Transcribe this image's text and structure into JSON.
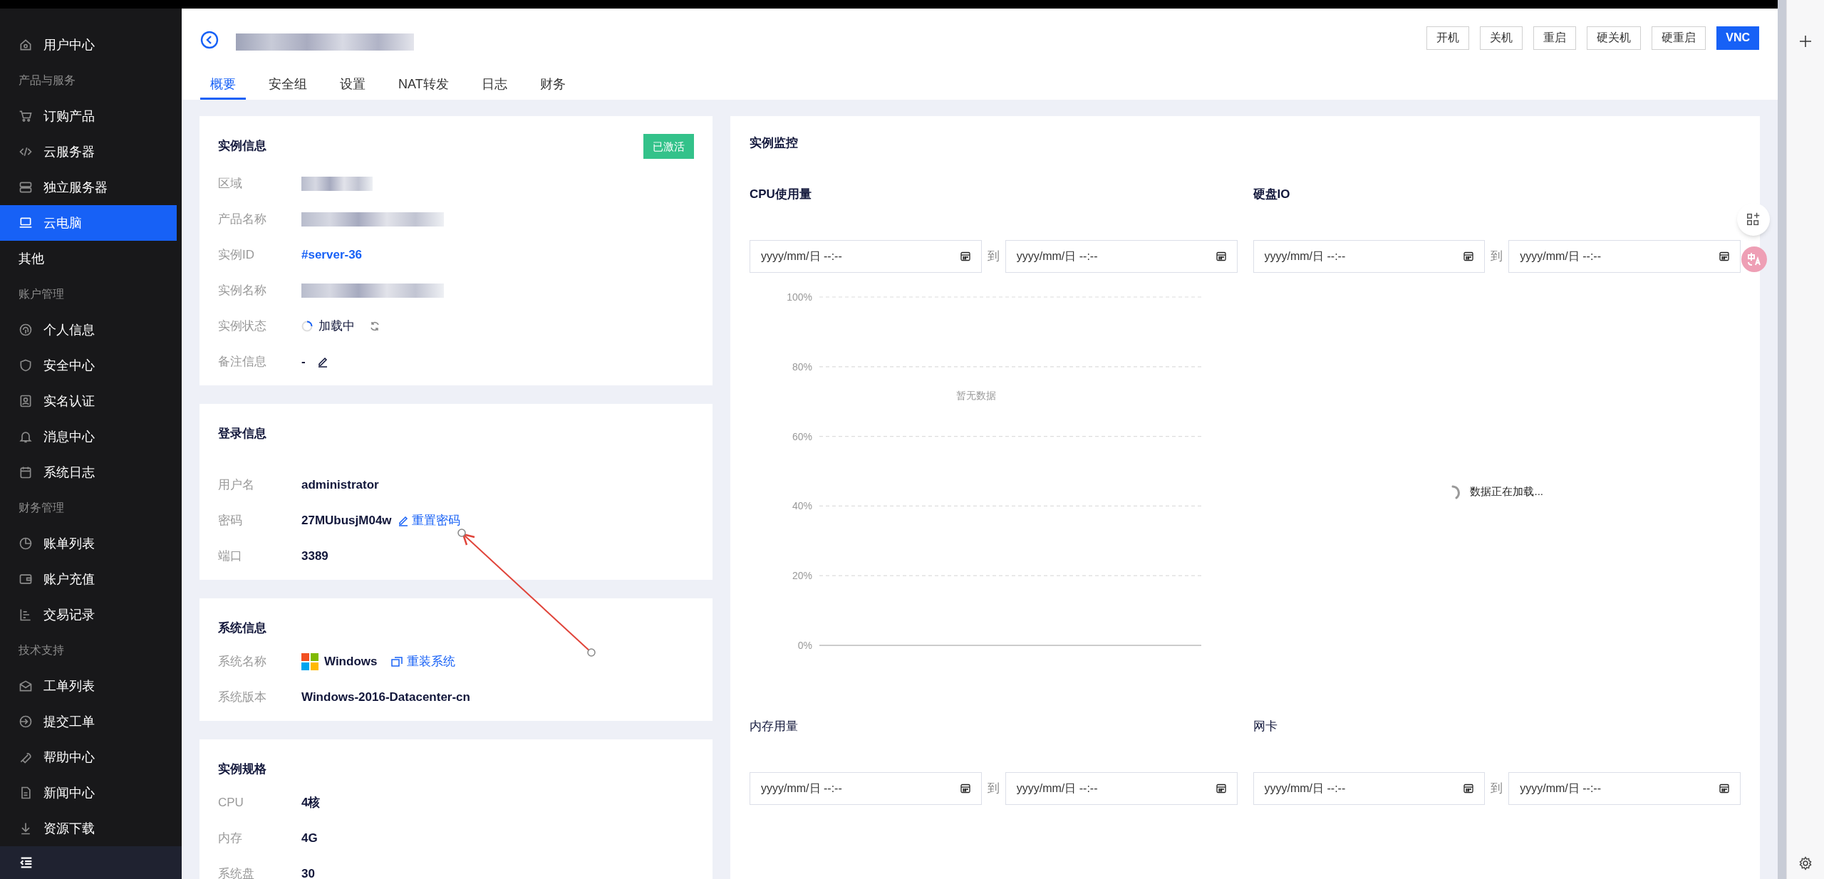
{
  "sidebar": {
    "items": [
      {
        "kind": "item",
        "label": "用户中心",
        "selected": false
      },
      {
        "kind": "section",
        "label": "产品与服务"
      },
      {
        "kind": "item",
        "label": "订购产品",
        "selected": false
      },
      {
        "kind": "item",
        "label": "云服务器",
        "selected": false
      },
      {
        "kind": "item",
        "label": "独立服务器",
        "selected": false
      },
      {
        "kind": "item",
        "label": "云电脑",
        "selected": true
      },
      {
        "kind": "plain",
        "label": "其他",
        "selected": false
      },
      {
        "kind": "section",
        "label": "账户管理"
      },
      {
        "kind": "item",
        "label": "个人信息",
        "selected": false
      },
      {
        "kind": "item",
        "label": "安全中心",
        "selected": false
      },
      {
        "kind": "item",
        "label": "实名认证",
        "selected": false
      },
      {
        "kind": "item",
        "label": "消息中心",
        "selected": false
      },
      {
        "kind": "item",
        "label": "系统日志",
        "selected": false
      },
      {
        "kind": "section",
        "label": "财务管理"
      },
      {
        "kind": "item",
        "label": "账单列表",
        "selected": false
      },
      {
        "kind": "item",
        "label": "账户充值",
        "selected": false
      },
      {
        "kind": "item",
        "label": "交易记录",
        "selected": false
      },
      {
        "kind": "section",
        "label": "技术支持"
      },
      {
        "kind": "item",
        "label": "工单列表",
        "selected": false
      },
      {
        "kind": "item",
        "label": "提交工单",
        "selected": false
      },
      {
        "kind": "item",
        "label": "帮助中心",
        "selected": false
      },
      {
        "kind": "item",
        "label": "新闻中心",
        "selected": false
      },
      {
        "kind": "item",
        "label": "资源下载",
        "selected": false
      }
    ]
  },
  "header": {
    "tabs": [
      {
        "label": "概要",
        "selected": true
      },
      {
        "label": "安全组",
        "selected": false
      },
      {
        "label": "设置",
        "selected": false
      },
      {
        "label": "NAT转发",
        "selected": false
      },
      {
        "label": "日志",
        "selected": false
      },
      {
        "label": "财务",
        "selected": false
      }
    ],
    "buttons": [
      {
        "label": "开机",
        "primary": false
      },
      {
        "label": "关机",
        "primary": false
      },
      {
        "label": "重启",
        "primary": false
      },
      {
        "label": "硬关机",
        "primary": false
      },
      {
        "label": "硬重启",
        "primary": false
      },
      {
        "label": "VNC",
        "primary": true
      }
    ]
  },
  "cards": [
    {
      "title": "实例信息",
      "badge": "已激活",
      "rows": [
        {
          "kind": "redacted",
          "label": "区域"
        },
        {
          "kind": "redacted",
          "label": "产品名称"
        },
        {
          "kind": "link",
          "label": "实例ID",
          "value": "#server-36"
        },
        {
          "kind": "redacted",
          "label": "实例名称"
        },
        {
          "kind": "status",
          "label": "实例状态",
          "value": "加载中"
        },
        {
          "kind": "note",
          "label": "备注信息",
          "value": "-"
        }
      ]
    },
    {
      "title": "登录信息",
      "rows": [
        {
          "kind": "text",
          "label": "用户名",
          "value": "administrator"
        },
        {
          "kind": "password",
          "label": "密码",
          "value": "27MUbusjM04w",
          "action": "重置密码"
        },
        {
          "kind": "text",
          "label": "端口",
          "value": "3389"
        }
      ]
    },
    {
      "title": "系统信息",
      "rows": [
        {
          "kind": "os",
          "label": "系统名称",
          "value": "Windows",
          "action": "重装系统"
        },
        {
          "kind": "text",
          "label": "系统版本",
          "value": "Windows-2016-Datacenter-cn"
        }
      ]
    },
    {
      "title": "实例规格",
      "rows": [
        {
          "kind": "text",
          "label": "CPU",
          "value": "4核"
        },
        {
          "kind": "text",
          "label": "内存",
          "value": "4G"
        },
        {
          "kind": "text",
          "label": "系统盘",
          "value": "30"
        }
      ]
    }
  ],
  "monitor": {
    "title": "实例监控",
    "panels": [
      {
        "title": "CPU使用量",
        "separator": "到",
        "start_placeholder": "yyyy/mm/日 --:--",
        "end_placeholder": "yyyy/mm/日 --:--",
        "content": {
          "kind": "chart",
          "empty_text": "暂无数据",
          "axis_labels": [
            "100%",
            "80%",
            "60%",
            "40%",
            "20%",
            "0%"
          ]
        }
      },
      {
        "title": "硬盘IO",
        "separator": "到",
        "start_placeholder": "yyyy/mm/日 --:--",
        "end_placeholder": "yyyy/mm/日 --:--",
        "content": {
          "kind": "loading",
          "text": "数据正在加载..."
        }
      },
      {
        "title": "内存用量",
        "separator": "到",
        "start_placeholder": "yyyy/mm/日 --:--",
        "end_placeholder": "yyyy/mm/日 --:--"
      },
      {
        "title": "网卡",
        "separator": "到",
        "start_placeholder": "yyyy/mm/日 --:--",
        "end_placeholder": "yyyy/mm/日 --:--"
      }
    ]
  }
}
